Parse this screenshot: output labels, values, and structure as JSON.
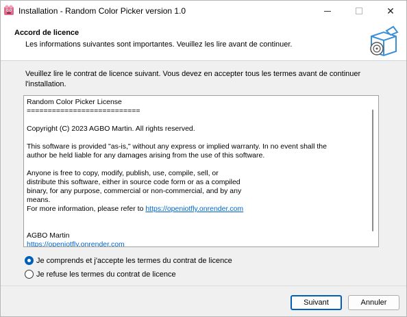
{
  "window": {
    "title": "Installation - Random Color Picker version 1.0",
    "app_icon": "installer-icon",
    "controls": {
      "minimize": "minimize-icon",
      "maximize": "maximize-icon",
      "close_glyph": "✕"
    }
  },
  "header": {
    "title": "Accord de licence",
    "subtitle": "Les informations suivantes sont importantes. Veuillez les lire avant de continuer.",
    "graphic": "installer-box-icon"
  },
  "instructions": "Veuillez lire le contrat de licence suivant. Vous devez en accepter tous les termes avant de continuer l'installation.",
  "license": {
    "lines": [
      "Random Color Picker License",
      "===========================",
      "",
      "Copyright (C) 2023 AGBO Martin. All rights reserved.",
      "",
      "This software is provided \"as-is,\" without any express or implied warranty. In no event shall the",
      "author be held liable for any damages arising from the use of this software.",
      "",
      "Anyone is free to copy, modify, publish, use, compile, sell, or",
      "distribute this software, either in source code form or as a compiled",
      "binary, for any purpose, commercial or non-commercial, and by any",
      "means.",
      "For more information, please refer to "
    ],
    "link_text": "https://openiotfly.onrender.com",
    "author": "AGBO Martin",
    "author_link": "https://openiotfly.onrender.com"
  },
  "options": {
    "accept_label": "Je comprends et j'accepte les termes du contrat de licence",
    "refuse_label": "Je refuse les termes du contrat de licence",
    "selected": "accept"
  },
  "buttons": {
    "next_label": "Suivant",
    "cancel_label": "Annuler"
  },
  "colors": {
    "accent": "#005fb8",
    "link": "#0066cc"
  }
}
